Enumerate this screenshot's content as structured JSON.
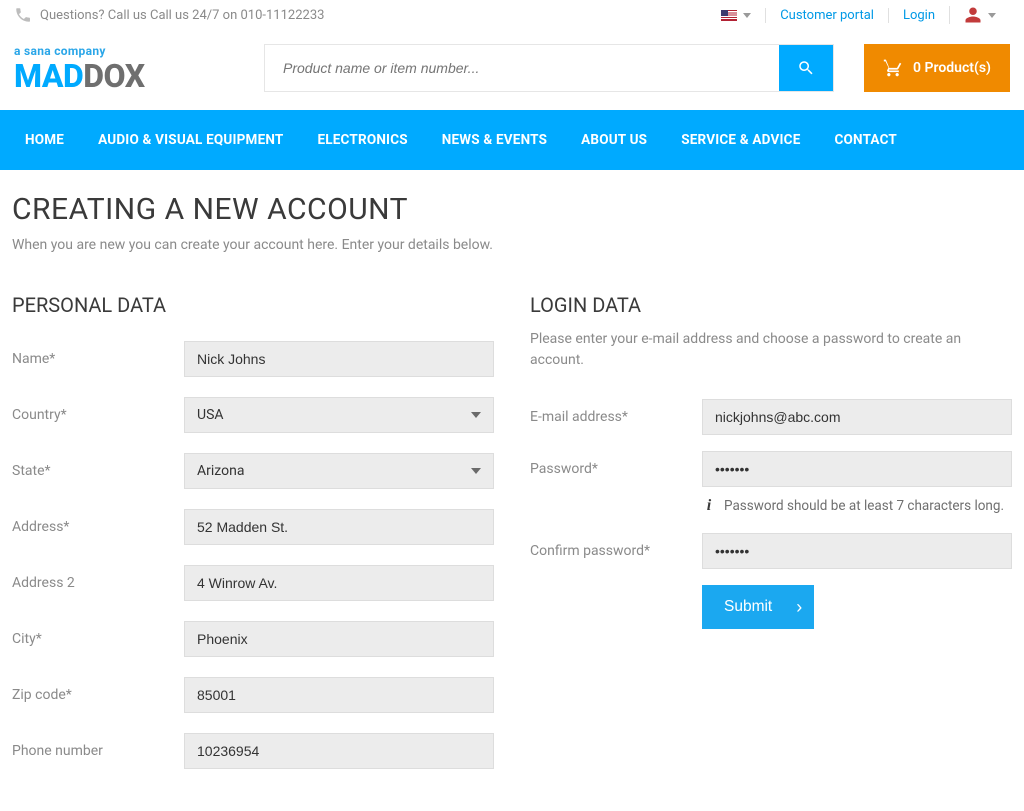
{
  "topbar": {
    "question_text": "Questions? Call us Call us 24/7 on 010-11122233",
    "customer_portal": "Customer portal",
    "login": "Login"
  },
  "header": {
    "tagline": "a sana company",
    "logo_left": "MAD",
    "logo_right": "DOX",
    "search_placeholder": "Product name or item number...",
    "cart_label": "0 Product(s)"
  },
  "nav": {
    "items": [
      "HOME",
      "AUDIO & VISUAL EQUIPMENT",
      "ELECTRONICS",
      "NEWS & EVENTS",
      "ABOUT US",
      "SERVICE & ADVICE",
      "CONTACT"
    ]
  },
  "page": {
    "title": "CREATING A NEW ACCOUNT",
    "intro": "When you are new you can create your account here. Enter your details below."
  },
  "personal": {
    "heading": "PERSONAL DATA",
    "fields": {
      "name_label": "Name*",
      "name_value": "Nick Johns",
      "country_label": "Country*",
      "country_value": "USA",
      "state_label": "State*",
      "state_value": "Arizona",
      "address_label": "Address*",
      "address_value": "52 Madden St.",
      "address2_label": "Address 2",
      "address2_value": "4 Winrow Av.",
      "city_label": "City*",
      "city_value": "Phoenix",
      "zip_label": "Zip code*",
      "zip_value": "85001",
      "phone_label": "Phone number",
      "phone_value": "10236954"
    }
  },
  "login_data": {
    "heading": "LOGIN DATA",
    "description": "Please enter your e-mail address and choose a password to create an account.",
    "email_label": "E-mail address*",
    "email_value": "nickjohns@abc.com",
    "password_label": "Password*",
    "password_value": "•••••••",
    "password_hint": "Password should be at least 7 characters long.",
    "confirm_label": "Confirm password*",
    "confirm_value": "•••••••",
    "submit_label": "Submit"
  }
}
